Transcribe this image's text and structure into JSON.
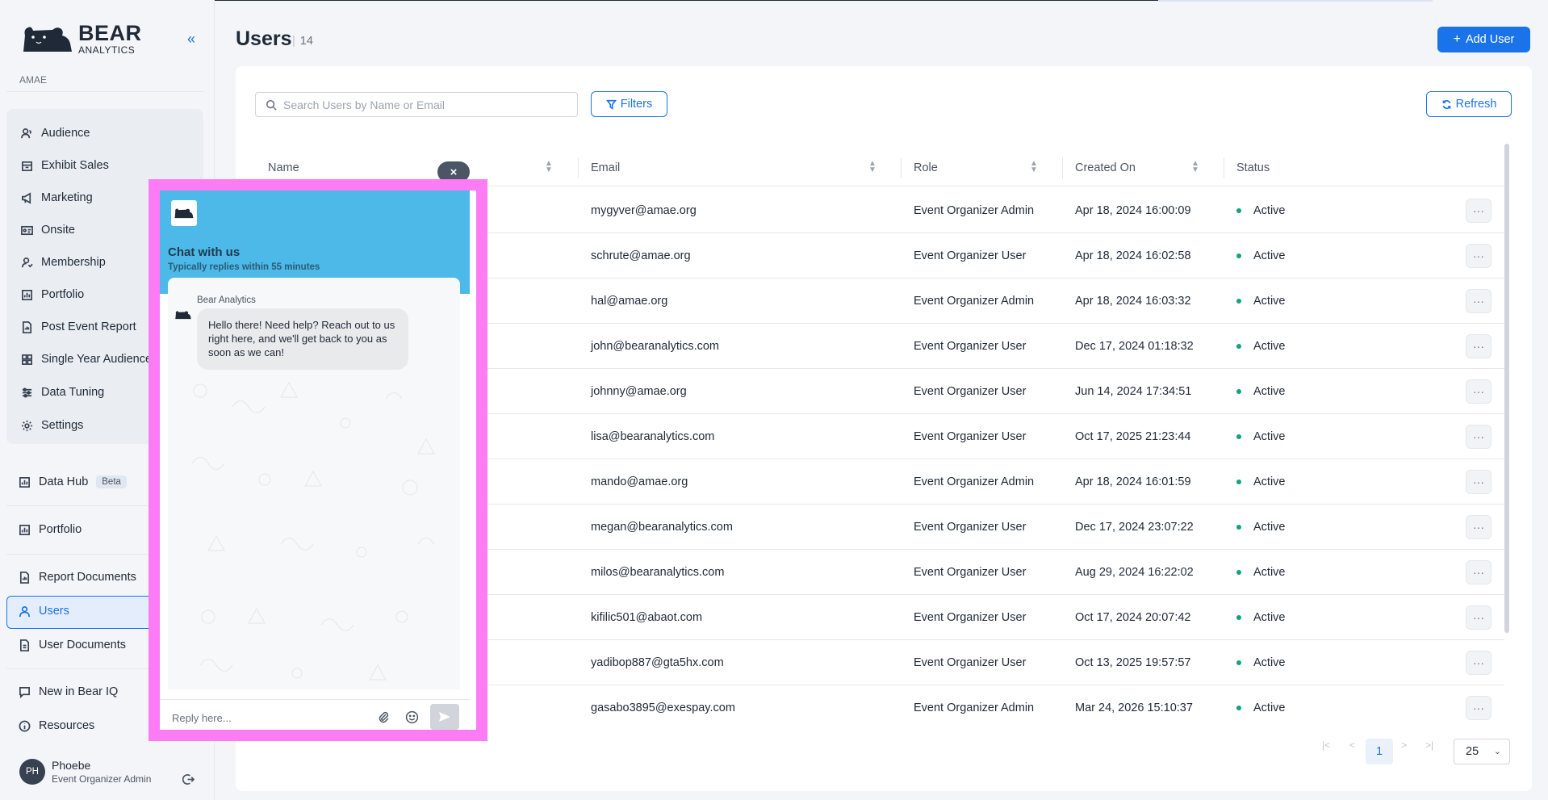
{
  "brand": {
    "name": "BEAR",
    "sub": "ANALYTICS"
  },
  "sidebar": {
    "collapse_glyph": "«",
    "org": "AMAE",
    "group_items": [
      {
        "label": "Audience",
        "icon": "users-icon"
      },
      {
        "label": "Exhibit Sales",
        "icon": "storefront-icon"
      },
      {
        "label": "Marketing",
        "icon": "megaphone-icon"
      },
      {
        "label": "Onsite",
        "icon": "id-card-icon"
      },
      {
        "label": "Membership",
        "icon": "member-icon"
      },
      {
        "label": "Portfolio",
        "icon": "chart-icon"
      },
      {
        "label": "Post Event Report",
        "icon": "report-icon"
      },
      {
        "label": "Single Year Audience",
        "icon": "grid-icon"
      },
      {
        "label": "Data Tuning",
        "icon": "sliders-icon"
      },
      {
        "label": "Settings",
        "icon": "gear-icon"
      }
    ],
    "data_hub": {
      "label": "Data Hub",
      "badge": "Beta"
    },
    "portfolio": "Portfolio",
    "report_documents": "Report Documents",
    "users": "Users",
    "user_documents": "User Documents",
    "new_in": "New in Bear IQ",
    "resources": "Resources",
    "user": {
      "initials": "PH",
      "name": "Phoebe",
      "role": "Event Organizer Admin"
    }
  },
  "header": {
    "title": "Users",
    "count": "14",
    "add_button": "Add User"
  },
  "toolbar": {
    "search_placeholder": "Search Users by Name or Email",
    "filters": "Filters",
    "refresh": "Refresh"
  },
  "table": {
    "columns": [
      "Name",
      "Email",
      "Role",
      "Created On",
      "Status"
    ],
    "rows": [
      {
        "email": "mygyver@amae.org",
        "role": "Event Organizer Admin",
        "created": "Apr 18, 2024 16:00:09",
        "status": "Active"
      },
      {
        "email": "schrute@amae.org",
        "role": "Event Organizer User",
        "created": "Apr 18, 2024 16:02:58",
        "status": "Active"
      },
      {
        "email": "hal@amae.org",
        "role": "Event Organizer Admin",
        "created": "Apr 18, 2024 16:03:32",
        "status": "Active"
      },
      {
        "email": "john@bearanalytics.com",
        "role": "Event Organizer User",
        "created": "Dec 17, 2024 01:18:32",
        "status": "Active"
      },
      {
        "email": "johnny@amae.org",
        "role": "Event Organizer User",
        "created": "Jun 14, 2024 17:34:51",
        "status": "Active"
      },
      {
        "email": "lisa@bearanalytics.com",
        "role": "Event Organizer User",
        "created": "Oct 17, 2025 21:23:44",
        "status": "Active"
      },
      {
        "email": "mando@amae.org",
        "role": "Event Organizer Admin",
        "created": "Apr 18, 2024 16:01:59",
        "status": "Active"
      },
      {
        "email": "megan@bearanalytics.com",
        "role": "Event Organizer User",
        "created": "Dec 17, 2024 23:07:22",
        "status": "Active"
      },
      {
        "email": "milos@bearanalytics.com",
        "role": "Event Organizer User",
        "created": "Aug 29, 2024 16:22:02",
        "status": "Active"
      },
      {
        "email": "kifilic501@abaot.com",
        "role": "Event Organizer User",
        "created": "Oct 17, 2024 20:07:42",
        "status": "Active"
      },
      {
        "email": "yadibop887@gta5hx.com",
        "role": "Event Organizer User",
        "created": "Oct 13, 2025 19:57:57",
        "status": "Active"
      },
      {
        "email": "gasabo3895@exespay.com",
        "role": "Event Organizer Admin",
        "created": "Mar 24, 2026 15:10:37",
        "status": "Active"
      }
    ],
    "row_action": "···"
  },
  "pagination": {
    "current_page": "1",
    "page_size": "25"
  },
  "chat": {
    "title": "Chat with us",
    "subtitle": "Typically replies within 55 minutes",
    "sender": "Bear Analytics",
    "message": "Hello there! Need help? Reach out to us right here, and we'll get back to you as soon as we can!",
    "reply_placeholder": "Reply here...",
    "close_glyph": "×",
    "frame_color": "#fb7cf5",
    "header_color": "#4cb9e8"
  },
  "colors": {
    "accent": "#1a73e8",
    "active_status": "#10a37f"
  }
}
